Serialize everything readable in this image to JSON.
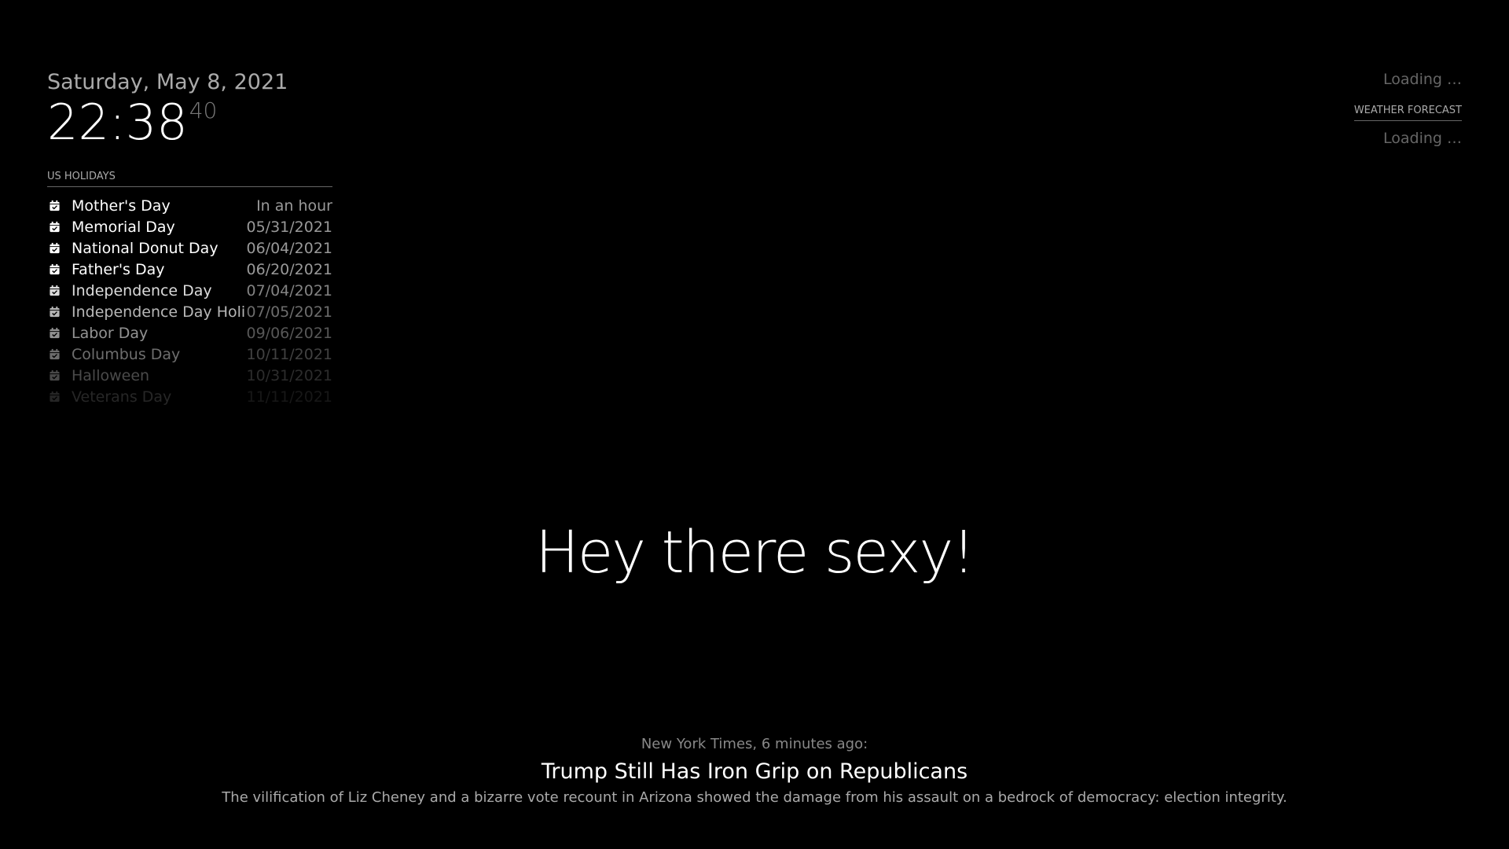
{
  "clock": {
    "date": "Saturday, May 8, 2021",
    "time": "22:38",
    "seconds": "40"
  },
  "calendar": {
    "header": "US HOLIDAYS",
    "icon": "calendar-check-icon",
    "events": [
      {
        "title": "Mother's Day",
        "when": "In an hour"
      },
      {
        "title": "Memorial Day",
        "when": "05/31/2021"
      },
      {
        "title": "National Donut Day",
        "when": "06/04/2021"
      },
      {
        "title": "Father's Day",
        "when": "06/20/2021"
      },
      {
        "title": "Independence Day",
        "when": "07/04/2021"
      },
      {
        "title": "Independence Day Holiday",
        "when": "07/05/2021"
      },
      {
        "title": "Labor Day",
        "when": "09/06/2021"
      },
      {
        "title": "Columbus Day",
        "when": "10/11/2021"
      },
      {
        "title": "Halloween",
        "when": "10/31/2021"
      },
      {
        "title": "Veterans Day",
        "when": "11/11/2021"
      }
    ]
  },
  "weather": {
    "current_loading": "Loading …",
    "forecast_header": "WEATHER FORECAST",
    "forecast_loading": "Loading …"
  },
  "compliment": {
    "text": "Hey there sexy!"
  },
  "news": {
    "source": "New York Times, 6 minutes ago:",
    "headline": "Trump Still Has Iron Grip on Republicans",
    "description": "The vilification of Liz Cheney and a bizarre vote recount in Arizona showed the damage from his assault on a bedrock of democracy: election integrity."
  }
}
